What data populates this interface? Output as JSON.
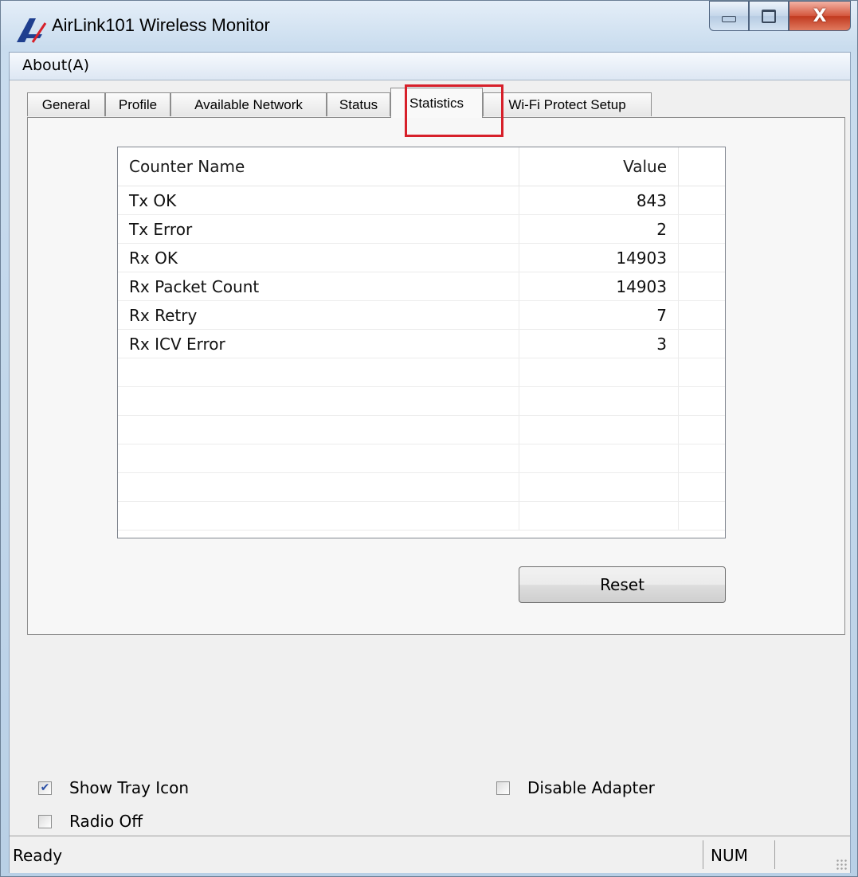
{
  "window": {
    "title": "AirLink101 Wireless Monitor",
    "icon": "airlink-logo-icon",
    "controls": {
      "minimize": "minimize-icon",
      "maximize": "maximize-icon",
      "close": "X"
    }
  },
  "menu": {
    "items": [
      {
        "label": "About(A)"
      }
    ]
  },
  "tabs": [
    {
      "label": "General"
    },
    {
      "label": "Profile"
    },
    {
      "label": "Available Network"
    },
    {
      "label": "Status"
    },
    {
      "label": "Statistics",
      "active": true
    },
    {
      "label": "Wi-Fi Protect Setup"
    }
  ],
  "highlight_color": "#d7202a",
  "statistics": {
    "columns": {
      "name": "Counter Name",
      "value": "Value"
    },
    "rows": [
      {
        "name": "Tx OK",
        "value": "843"
      },
      {
        "name": "Tx Error",
        "value": "2"
      },
      {
        "name": "Rx OK",
        "value": "14903"
      },
      {
        "name": "Rx Packet Count",
        "value": "14903"
      },
      {
        "name": "Rx Retry",
        "value": "7"
      },
      {
        "name": "Rx ICV Error",
        "value": "3"
      }
    ],
    "reset_label": "Reset"
  },
  "options": {
    "show_tray_icon": {
      "label": "Show Tray Icon",
      "checked": true
    },
    "radio_off": {
      "label": "Radio Off",
      "checked": false
    },
    "disable_adapter": {
      "label": "Disable Adapter",
      "checked": false
    }
  },
  "statusbar": {
    "text": "Ready",
    "num": "NUM"
  }
}
